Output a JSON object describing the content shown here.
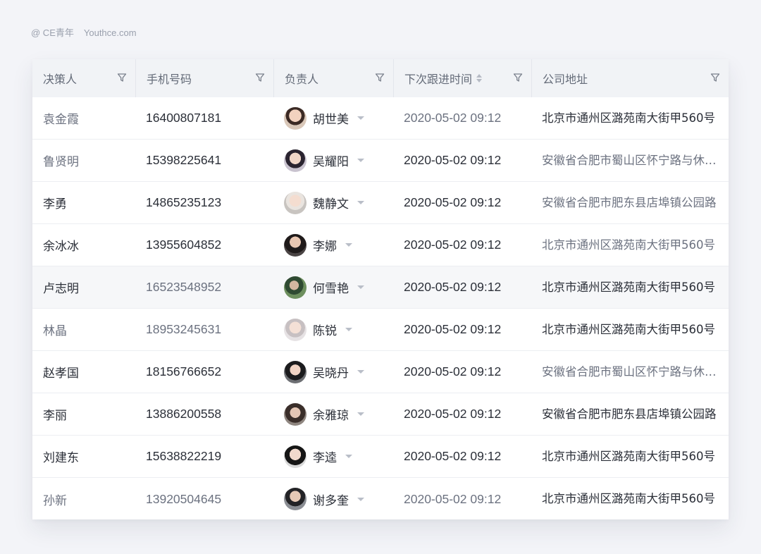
{
  "watermark": {
    "brand": "@ CE青年",
    "site": "Youthce.com"
  },
  "columns": {
    "decision_maker": "决策人",
    "phone": "手机号码",
    "owner": "负责人",
    "next_follow": "下次跟进时间",
    "address": "公司地址"
  },
  "rows": [
    {
      "name": "袁金霞",
      "phone": "16400807181",
      "owner": "胡世美",
      "time": "2020-05-02 09:12",
      "address": "北京市通州区潞苑南大街甲560号",
      "name_tone": "light",
      "phone_tone": "dark",
      "time_tone": "light",
      "addr_tone": "dark"
    },
    {
      "name": "鲁贤明",
      "phone": "15398225641",
      "owner": "吴耀阳",
      "time": "2020-05-02 09:12",
      "address": "安徽省合肥市蜀山区怀宁路与休宁路交口",
      "name_tone": "light",
      "phone_tone": "dark",
      "time_tone": "dark",
      "addr_tone": "light"
    },
    {
      "name": "李勇",
      "phone": "14865235123",
      "owner": "魏静文",
      "time": "2020-05-02 09:12",
      "address": "安徽省合肥市肥东县店埠镇公园路",
      "name_tone": "dark",
      "phone_tone": "dark",
      "time_tone": "dark",
      "addr_tone": "light"
    },
    {
      "name": "余冰冰",
      "phone": "13955604852",
      "owner": "李娜",
      "time": "2020-05-02 09:12",
      "address": "北京市通州区潞苑南大街甲560号",
      "name_tone": "dark",
      "phone_tone": "dark",
      "time_tone": "dark",
      "addr_tone": "light"
    },
    {
      "name": "卢志明",
      "phone": "16523548952",
      "owner": "何雪艳",
      "time": "2020-05-02 09:12",
      "address": "北京市通州区潞苑南大街甲560号",
      "name_tone": "dark",
      "phone_tone": "light",
      "time_tone": "dark",
      "addr_tone": "dark"
    },
    {
      "name": "林晶",
      "phone": "18953245631",
      "owner": "陈锐",
      "time": "2020-05-02 09:12",
      "address": "北京市通州区潞苑南大街甲560号",
      "name_tone": "light",
      "phone_tone": "light",
      "time_tone": "dark",
      "addr_tone": "dark"
    },
    {
      "name": "赵孝国",
      "phone": "18156766652",
      "owner": "吴晓丹",
      "time": "2020-05-02 09:12",
      "address": "安徽省合肥市蜀山区怀宁路与休宁路交口",
      "name_tone": "dark",
      "phone_tone": "dark",
      "time_tone": "dark",
      "addr_tone": "light"
    },
    {
      "name": "李丽",
      "phone": "13886200558",
      "owner": "余雅琼",
      "time": "2020-05-02 09:12",
      "address": "安徽省合肥市肥东县店埠镇公园路",
      "name_tone": "dark",
      "phone_tone": "dark",
      "time_tone": "dark",
      "addr_tone": "dark"
    },
    {
      "name": "刘建东",
      "phone": "15638822219",
      "owner": "李逵",
      "time": "2020-05-02 09:12",
      "address": "北京市通州区潞苑南大街甲560号",
      "name_tone": "dark",
      "phone_tone": "dark",
      "time_tone": "dark",
      "addr_tone": "dark"
    },
    {
      "name": "孙新",
      "phone": "13920504645",
      "owner": "谢多奎",
      "time": "2020-05-02 09:12",
      "address": "北京市通州区潞苑南大街甲560号",
      "name_tone": "light",
      "phone_tone": "light",
      "time_tone": "light",
      "addr_tone": "dark"
    }
  ],
  "hovered_row": 4,
  "icons": {
    "filter": "filter-icon",
    "sort": "sort-icon",
    "dropdown": "chevron-down-icon"
  }
}
